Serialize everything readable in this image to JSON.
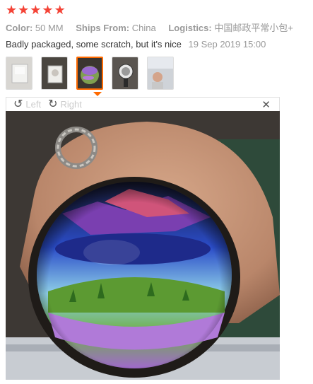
{
  "rating": {
    "stars": 5,
    "color": "#f44336"
  },
  "meta": {
    "color_label": "Color:",
    "color_value": "50 MM",
    "ships_label": "Ships From:",
    "ships_value": "China",
    "logistics_label": "Logistics:",
    "logistics_value": "中国邮政平常小包+"
  },
  "review": {
    "text": "Badly packaged, some scratch, but it's nice",
    "date": "19 Sep 2019 15:00"
  },
  "thumbnails": [
    {
      "name": "thumb-1",
      "active": false
    },
    {
      "name": "thumb-2",
      "active": false
    },
    {
      "name": "thumb-3",
      "active": true
    },
    {
      "name": "thumb-4",
      "active": false
    },
    {
      "name": "thumb-5",
      "active": false
    }
  ],
  "toolbar": {
    "rotate_left_label": "Left",
    "rotate_right_label": "Right"
  },
  "colors": {
    "accent": "#ff6a00",
    "muted": "#999999"
  }
}
